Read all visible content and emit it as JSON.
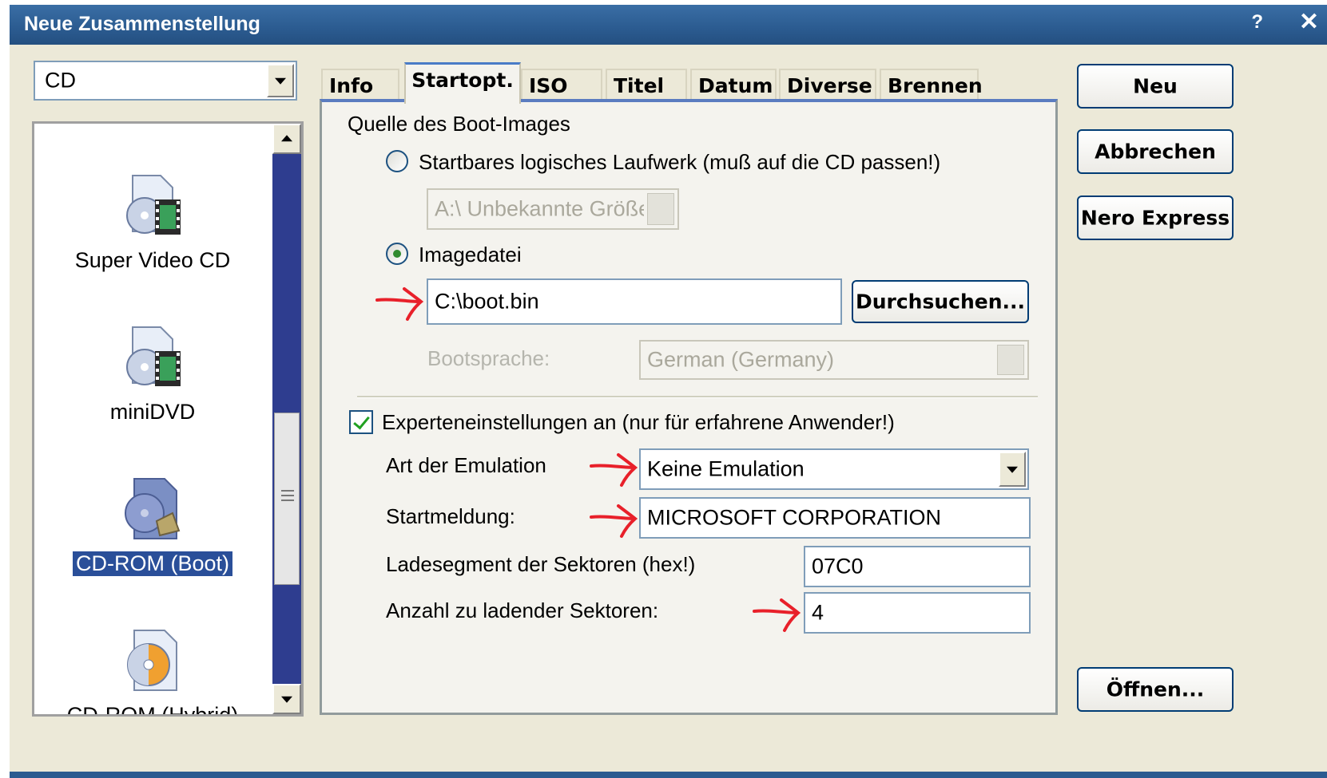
{
  "window": {
    "title": "Neue Zusammenstellung",
    "help_label": "?",
    "close_label": "✕"
  },
  "media_combo": {
    "value": "CD"
  },
  "project_list": {
    "items": [
      {
        "label": "Super Video CD",
        "icon": "video-cd-icon",
        "selected": false
      },
      {
        "label": "miniDVD",
        "icon": "video-disc-icon",
        "selected": false
      },
      {
        "label": "CD-ROM (Boot)",
        "icon": "boot-cd-icon",
        "selected": true
      },
      {
        "label": "CD-ROM (Hybrid)",
        "icon": "hybrid-cd-icon",
        "selected": false
      }
    ]
  },
  "tabs": [
    {
      "label": "Info"
    },
    {
      "label": "Startopt."
    },
    {
      "label": "ISO"
    },
    {
      "label": "Titel"
    },
    {
      "label": "Datum"
    },
    {
      "label": "Diverse"
    },
    {
      "label": "Brennen"
    }
  ],
  "boot_tab": {
    "source_group_label": "Quelle des Boot-Images",
    "radio_drive_label": "Startbares logisches Laufwerk (muß auf die CD passen!)",
    "drive_combo_value": "A:\\  Unbekannte Größe",
    "radio_image_label": "Imagedatei",
    "image_path": "C:\\boot.bin",
    "browse_label": "Durchsuchen...",
    "boot_language_label": "Bootsprache:",
    "boot_language_value": "German (Germany)",
    "expert_checkbox_label": "Experteneinstellungen an (nur für erfahrene Anwender!)",
    "emulation_label": "Art der Emulation",
    "emulation_value": "Keine Emulation",
    "boot_message_label": "Startmeldung:",
    "boot_message_value": "MICROSOFT CORPORATION",
    "load_segment_label": "Ladesegment der Sektoren (hex!)",
    "load_segment_value": "07C0",
    "sector_count_label": "Anzahl zu ladender Sektoren:",
    "sector_count_value": "4"
  },
  "buttons": {
    "new": "Neu",
    "cancel": "Abbrechen",
    "nero_express": "Nero Express",
    "open": "Öffnen..."
  },
  "colors": {
    "annotation_arrow": "#e8202a",
    "selection": "#2a4f99"
  }
}
